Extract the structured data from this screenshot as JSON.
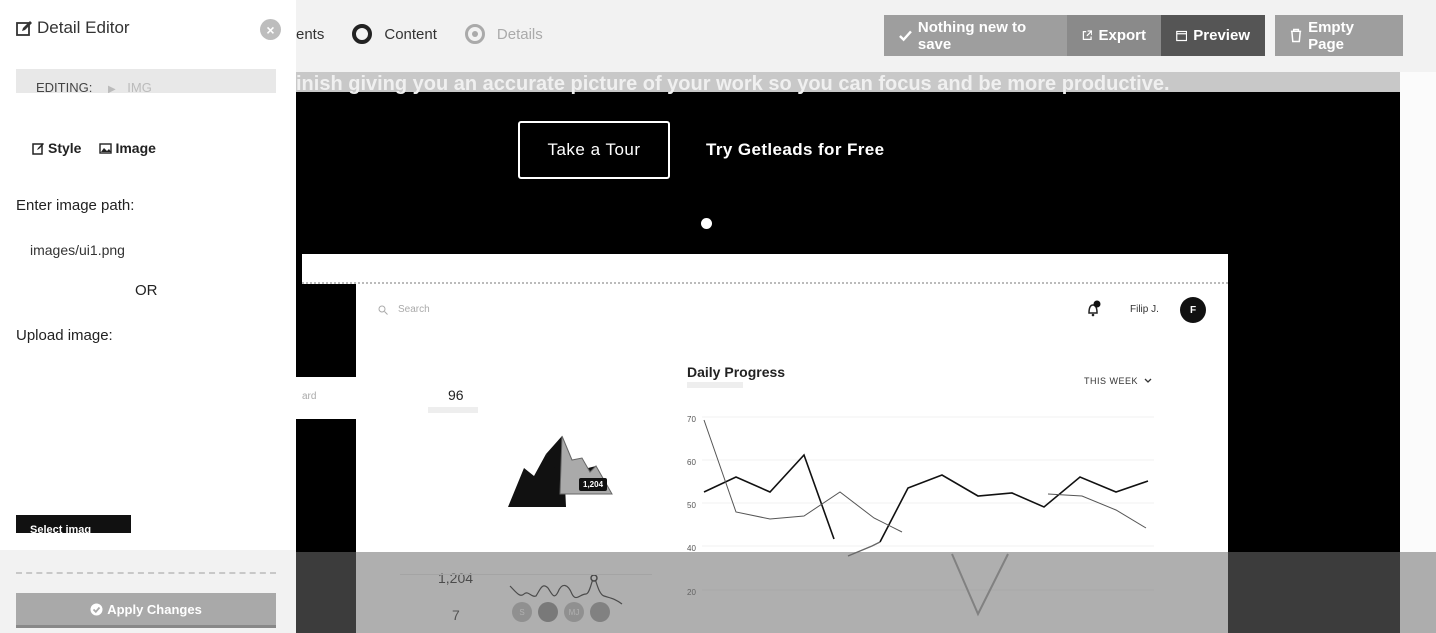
{
  "steps": {
    "items": [
      {
        "label": "ents"
      },
      {
        "label": "Content"
      },
      {
        "label": "Details"
      }
    ]
  },
  "toolbar": {
    "save_label": "Nothing new to save",
    "export_label": "Export",
    "preview_label": "Preview",
    "empty_label": "Empty Page"
  },
  "canvas": {
    "tagline": "inish giving you an accurate picture of your work so you can focus and be more productive.",
    "tour_button": "Take a Tour",
    "free_link": "Try Getleads for Free",
    "left_tab_text": "ard"
  },
  "mockup": {
    "search_placeholder": "Search",
    "user_name": "Filip J.",
    "avatar_letter": "F",
    "stat1_value": "96",
    "stat2_value": "1,204",
    "tooltip_value": "1,204",
    "stat3_value": "7",
    "avatars": [
      "S",
      "",
      "MJ",
      ""
    ],
    "chart_title": "Daily Progress",
    "week_filter": "THIS WEEK",
    "y_ticks": [
      "70",
      "60",
      "50",
      "40",
      "20"
    ]
  },
  "sidebar": {
    "title": "Detail Editor",
    "editing_label": "EDITING:",
    "editing_tag": "IMG",
    "tabs": [
      {
        "label": "Style"
      },
      {
        "label": "Image"
      }
    ],
    "path_label": "Enter image path:",
    "path_value": "images/ui1.png",
    "or_label": "OR",
    "upload_label": "Upload image:",
    "select_label": "Select imag",
    "apply_label": "Apply Changes"
  }
}
